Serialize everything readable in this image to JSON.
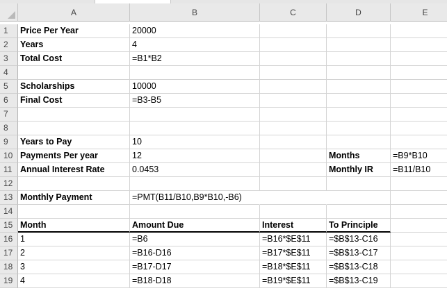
{
  "columns": [
    "A",
    "B",
    "C",
    "D",
    "E"
  ],
  "rows": [
    {
      "num": "1",
      "a": "Price Per Year",
      "b": "20000",
      "c": "",
      "d": "",
      "e": ""
    },
    {
      "num": "2",
      "a": "Years",
      "b": "4",
      "c": "",
      "d": "",
      "e": ""
    },
    {
      "num": "3",
      "a": "Total Cost",
      "b": "=B1*B2",
      "c": "",
      "d": "",
      "e": ""
    },
    {
      "num": "4",
      "a": "",
      "b": "",
      "c": "",
      "d": "",
      "e": ""
    },
    {
      "num": "5",
      "a": "Scholarships",
      "b": "10000",
      "c": "",
      "d": "",
      "e": ""
    },
    {
      "num": "6",
      "a": "Final Cost",
      "b": "=B3-B5",
      "c": "",
      "d": "",
      "e": ""
    },
    {
      "num": "7",
      "a": "",
      "b": "",
      "c": "",
      "d": "",
      "e": ""
    },
    {
      "num": "8",
      "a": "",
      "b": "",
      "c": "",
      "d": "",
      "e": ""
    },
    {
      "num": "9",
      "a": "Years to Pay",
      "b": "10",
      "c": "",
      "d": "",
      "e": ""
    },
    {
      "num": "10",
      "a": "Payments Per year",
      "b": "12",
      "c": "",
      "d": "Months",
      "e": "=B9*B10"
    },
    {
      "num": "11",
      "a": "Annual Interest Rate",
      "b": "0.0453",
      "c": "",
      "d": "Monthly IR",
      "e": "=B11/B10"
    },
    {
      "num": "12",
      "a": "",
      "b": "",
      "c": "",
      "d": "",
      "e": ""
    },
    {
      "num": "13",
      "a": "Monthly Payment",
      "b": "=PMT(B11/B10,B9*B10,-B6)",
      "c": "",
      "d": "",
      "e": ""
    },
    {
      "num": "14",
      "a": "",
      "b": "",
      "c": "",
      "d": "",
      "e": ""
    },
    {
      "num": "15",
      "a": "Month",
      "b": "Amount Due",
      "c": "Interest",
      "d": "To Principle",
      "e": ""
    },
    {
      "num": "16",
      "a": "1",
      "b": "=B6",
      "c": "=B16*$E$11",
      "d": "=$B$13-C16",
      "e": ""
    },
    {
      "num": "17",
      "a": "2",
      "b": "=B16-D16",
      "c": "=B17*$E$11",
      "d": "=$B$13-C17",
      "e": ""
    },
    {
      "num": "18",
      "a": "3",
      "b": "=B17-D17",
      "c": "=B18*$E$11",
      "d": "=$B$13-C18",
      "e": ""
    },
    {
      "num": "19",
      "a": "4",
      "b": "=B18-D18",
      "c": "=B19*$E$11",
      "d": "=$B$13-C19",
      "e": ""
    }
  ]
}
